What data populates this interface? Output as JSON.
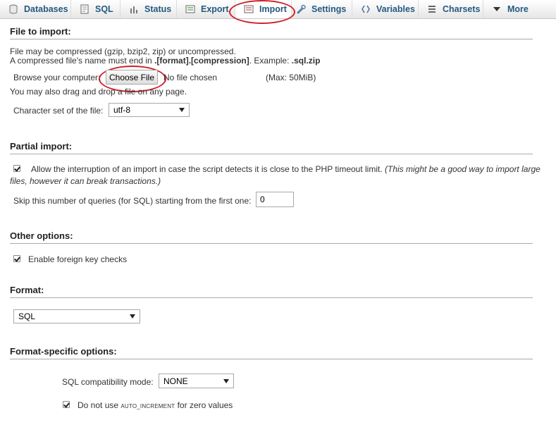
{
  "tabs": [
    {
      "label": "Databases",
      "icon": "database-icon"
    },
    {
      "label": "SQL",
      "icon": "sql-icon"
    },
    {
      "label": "Status",
      "icon": "status-icon"
    },
    {
      "label": "Export",
      "icon": "export-icon"
    },
    {
      "label": "Import",
      "icon": "import-icon"
    },
    {
      "label": "Settings",
      "icon": "wrench-icon"
    },
    {
      "label": "Variables",
      "icon": "variables-icon"
    },
    {
      "label": "Charsets",
      "icon": "charsets-icon"
    },
    {
      "label": "More",
      "icon": "chevron-down-icon"
    }
  ],
  "file_section": {
    "heading": "File to import:",
    "line1": "File may be compressed (gzip, bzip2, zip) or uncompressed.",
    "line2_prefix": "A compressed file's name must end in ",
    "line2_format": ".[format].[compression]",
    "line2_mid": ". Example: ",
    "line2_example": ".sql.zip",
    "browse_label": "Browse your computer:",
    "choose_button": "Choose File",
    "no_file": "No file chosen",
    "max_size": "(Max: 50MiB)",
    "drag_hint": "You may also drag and drop a file on any page.",
    "charset_label": "Character set of the file:",
    "charset_value": "utf-8"
  },
  "partial_section": {
    "heading": "Partial import:",
    "allow_interrupt_text": "Allow the interruption of an import in case the script detects it is close to the PHP timeout limit.",
    "allow_interrupt_hint_part1": "(This might be a good way to import large",
    "allow_interrupt_hint_part2": "files, however it can break transactions.)",
    "allow_interrupt_checked": true,
    "skip_label": "Skip this number of queries (for SQL) starting from the first one:",
    "skip_value": "0"
  },
  "other_section": {
    "heading": "Other options:",
    "fk_label": "Enable foreign key checks",
    "fk_checked": true
  },
  "format_section": {
    "heading": "Format:",
    "format_value": "SQL"
  },
  "format_specific": {
    "heading": "Format-specific options:",
    "compat_label": "SQL compatibility mode:",
    "compat_value": "NONE",
    "no_autoinc_prefix": "Do not use ",
    "no_autoinc_code": "AUTO_INCREMENT",
    "no_autoinc_suffix": " for zero values",
    "no_autoinc_checked": true
  },
  "colors": {
    "tab_text": "#235a81",
    "callout": "#d0202a"
  }
}
